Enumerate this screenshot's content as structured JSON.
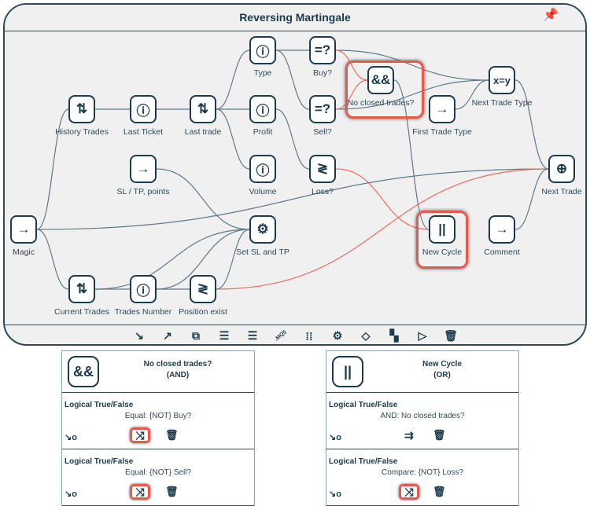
{
  "window": {
    "title": "Reversing Martingale",
    "pin_icon": "pin-icon"
  },
  "colors": {
    "accent": "#1b3a4b",
    "edge": "#5f7a88",
    "edge_active": "#ef6a62",
    "highlight": "#e8584b"
  },
  "nodes": [
    {
      "id": "magic",
      "label": "Magic",
      "icon": "→"
    },
    {
      "id": "history",
      "label": "History Trades",
      "icon": "⇅"
    },
    {
      "id": "lastticket",
      "label": "Last Ticket",
      "icon": "ⓘ"
    },
    {
      "id": "lasttrade",
      "label": "Last trade",
      "icon": "⇅"
    },
    {
      "id": "type",
      "label": "Type",
      "icon": "ⓘ"
    },
    {
      "id": "buy",
      "label": "Buy?",
      "icon": "=?"
    },
    {
      "id": "profit",
      "label": "Profit",
      "icon": "ⓘ"
    },
    {
      "id": "sell",
      "label": "Sell?",
      "icon": "=?"
    },
    {
      "id": "volume",
      "label": "Volume",
      "icon": "ⓘ"
    },
    {
      "id": "loss",
      "label": "Loss?",
      "icon": "≷"
    },
    {
      "id": "sltp",
      "label": "SL / TP, points",
      "icon": "→"
    },
    {
      "id": "setsl",
      "label": "Set SL and TP",
      "icon": "⚙"
    },
    {
      "id": "current",
      "label": "Current Trades",
      "icon": "⇅"
    },
    {
      "id": "tradesnum",
      "label": "Trades Number",
      "icon": "ⓘ"
    },
    {
      "id": "posexist",
      "label": "Position exist",
      "icon": "≷"
    },
    {
      "id": "and",
      "label": "No closed trades?",
      "icon": "&&"
    },
    {
      "id": "firsttype",
      "label": "First Trade Type",
      "icon": "→"
    },
    {
      "id": "xy",
      "label": "Next Trade Type",
      "icon": "x=y"
    },
    {
      "id": "nexttrade",
      "label": "Next Trade",
      "icon": "⊕"
    },
    {
      "id": "newcycle",
      "label": "New Cycle",
      "icon": "||"
    },
    {
      "id": "comment",
      "label": "Comment",
      "icon": "→"
    }
  ],
  "edges": [
    {
      "from": "magic",
      "to": "history"
    },
    {
      "from": "magic",
      "to": "current"
    },
    {
      "from": "magic",
      "to": "nexttrade"
    },
    {
      "from": "history",
      "to": "lastticket"
    },
    {
      "from": "lastticket",
      "to": "lasttrade"
    },
    {
      "from": "lasttrade",
      "to": "type"
    },
    {
      "from": "lasttrade",
      "to": "profit"
    },
    {
      "from": "lasttrade",
      "to": "volume"
    },
    {
      "from": "type",
      "to": "buy"
    },
    {
      "from": "type",
      "to": "sell"
    },
    {
      "from": "profit",
      "to": "loss"
    },
    {
      "from": "buy",
      "to": "xy"
    },
    {
      "from": "sell",
      "to": "xy"
    },
    {
      "from": "buy",
      "to": "and",
      "active": true
    },
    {
      "from": "sell",
      "to": "and",
      "active": true
    },
    {
      "from": "and",
      "to": "newcycle"
    },
    {
      "from": "loss",
      "to": "newcycle",
      "active": true
    },
    {
      "from": "posexist",
      "to": "nexttrade",
      "active": true
    },
    {
      "from": "sltp",
      "to": "setsl"
    },
    {
      "from": "current",
      "to": "tradesnum"
    },
    {
      "from": "tradesnum",
      "to": "posexist"
    },
    {
      "from": "tradesnum",
      "to": "setsl"
    },
    {
      "from": "posexist",
      "to": "setsl"
    },
    {
      "from": "current",
      "to": "setsl"
    },
    {
      "from": "firsttype",
      "to": "xy"
    },
    {
      "from": "xy",
      "to": "nexttrade"
    },
    {
      "from": "comment",
      "to": "nexttrade"
    }
  ],
  "toolbar": [
    "↘",
    "↗",
    "⧉",
    "☰",
    "☰",
    ".MQ5",
    "⁞⁞",
    "⚙",
    "◇",
    "▚",
    "▷",
    "🗑"
  ],
  "panels": [
    {
      "icon": "&&",
      "title": "No closed trades?",
      "subtitle": "(AND)",
      "sections": [
        {
          "title": "Logical True/False",
          "desc": "Equal: {NOT} Buy?",
          "toggle": "⤨",
          "toggle_active": true
        },
        {
          "title": "Logical True/False",
          "desc": "Equal: {NOT} Sell?",
          "toggle": "⤨",
          "toggle_active": true
        }
      ]
    },
    {
      "icon": "||",
      "title": "New Cycle",
      "subtitle": "(OR)",
      "sections": [
        {
          "title": "Logical True/False",
          "desc": "AND: No closed trades?",
          "toggle": "⇉",
          "toggle_active": false
        },
        {
          "title": "Logical True/False",
          "desc": "Compare: {NOT} Loss?",
          "toggle": "⤨",
          "toggle_active": true
        }
      ]
    }
  ]
}
